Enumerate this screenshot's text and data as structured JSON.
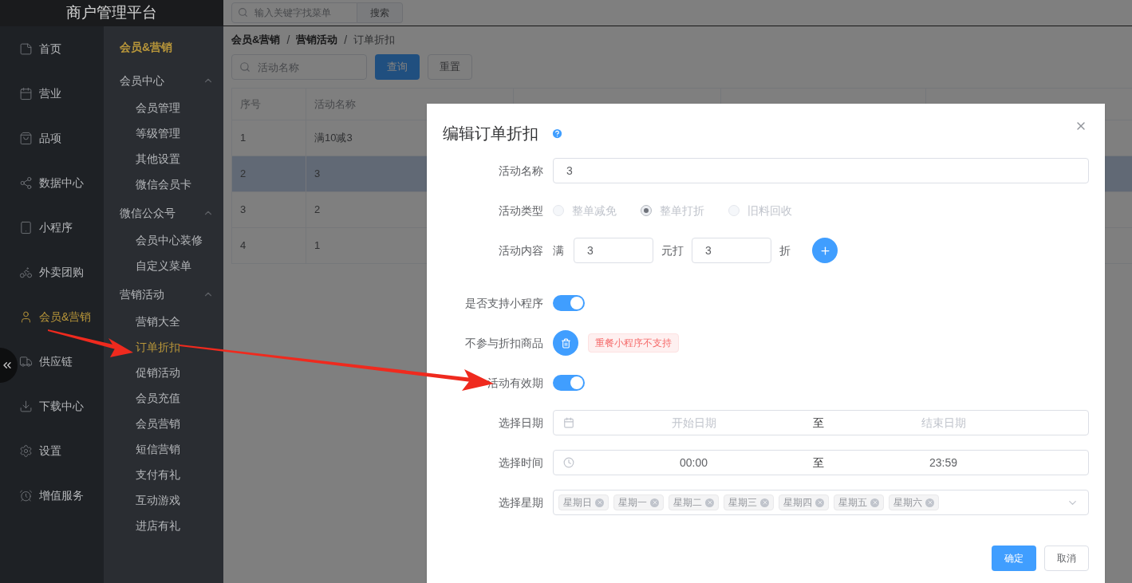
{
  "app_title": "商户管理平台",
  "nav": [
    {
      "label": "首页",
      "selected": false
    },
    {
      "label": "营业",
      "selected": false
    },
    {
      "label": "品项",
      "selected": false
    },
    {
      "label": "数据中心",
      "selected": false
    },
    {
      "label": "小程序",
      "selected": false
    },
    {
      "label": "外卖团购",
      "selected": false
    },
    {
      "label": "会员&营销",
      "selected": true
    },
    {
      "label": "供应链",
      "selected": false
    },
    {
      "label": "下载中心",
      "selected": false
    },
    {
      "label": "设置",
      "selected": false
    },
    {
      "label": "增值服务",
      "selected": false
    }
  ],
  "submenu": {
    "title": "会员&营销",
    "groups": [
      {
        "title": "会员中心",
        "expanded": true,
        "items": [
          {
            "label": "会员管理",
            "selected": false
          },
          {
            "label": "等级管理",
            "selected": false
          },
          {
            "label": "其他设置",
            "selected": false
          },
          {
            "label": "微信会员卡",
            "selected": false
          }
        ]
      },
      {
        "title": "微信公众号",
        "expanded": true,
        "items": [
          {
            "label": "会员中心装修",
            "selected": false
          },
          {
            "label": "自定义菜单",
            "selected": false
          }
        ]
      },
      {
        "title": "营销活动",
        "expanded": true,
        "items": [
          {
            "label": "营销大全",
            "selected": false
          },
          {
            "label": "订单折扣",
            "selected": true
          },
          {
            "label": "促销活动",
            "selected": false
          },
          {
            "label": "会员充值",
            "selected": false
          },
          {
            "label": "会员营销",
            "selected": false
          },
          {
            "label": "短信营销",
            "selected": false
          },
          {
            "label": "支付有礼",
            "selected": false
          },
          {
            "label": "互动游戏",
            "selected": false
          },
          {
            "label": "进店有礼",
            "selected": false
          }
        ]
      }
    ]
  },
  "topbar": {
    "search_placeholder": "输入关键字找菜单",
    "search_button": "搜索"
  },
  "breadcrumb": [
    "会员&营销",
    "营销活动",
    "订单折扣"
  ],
  "breadcrumb_separator": "/",
  "filter": {
    "placeholder": "活动名称",
    "query_button": "查询",
    "reset_button": "重置"
  },
  "table": {
    "columns": [
      "序号",
      "活动名称"
    ],
    "rows": [
      {
        "cells": [
          "1",
          "满10减3"
        ],
        "selected": false
      },
      {
        "cells": [
          "2",
          "3"
        ],
        "selected": true
      },
      {
        "cells": [
          "3",
          "2"
        ],
        "selected": false
      },
      {
        "cells": [
          "4",
          "1"
        ],
        "selected": false
      }
    ]
  },
  "dialog": {
    "title": "编辑订单折扣",
    "name": {
      "label": "活动名称",
      "value": "3"
    },
    "type": {
      "label": "活动类型",
      "options": [
        {
          "label": "整单减免",
          "selected": false,
          "disabled": true
        },
        {
          "label": "整单打折",
          "selected": true,
          "disabled": true
        },
        {
          "label": "旧料回收",
          "selected": false,
          "disabled": true
        }
      ]
    },
    "content": {
      "label": "活动内容",
      "prefix": "满",
      "amount": "3",
      "middle": "元打",
      "discount": "3",
      "suffix": "折"
    },
    "mini_program": {
      "label": "是否支持小程序",
      "on": true
    },
    "excluded": {
      "label": "不参与折扣商品",
      "tag": "重餐小程序不支持"
    },
    "validity": {
      "label": "活动有效期",
      "on": true
    },
    "date": {
      "label": "选择日期",
      "start_placeholder": "开始日期",
      "separator": "至",
      "end_placeholder": "结束日期"
    },
    "time": {
      "label": "选择时间",
      "start": "00:00",
      "separator": "至",
      "end": "23:59"
    },
    "weekdays": {
      "label": "选择星期",
      "tags": [
        "星期日",
        "星期一",
        "星期二",
        "星期三",
        "星期四",
        "星期五",
        "星期六"
      ]
    },
    "confirm_button": "确定",
    "cancel_button": "取消"
  }
}
